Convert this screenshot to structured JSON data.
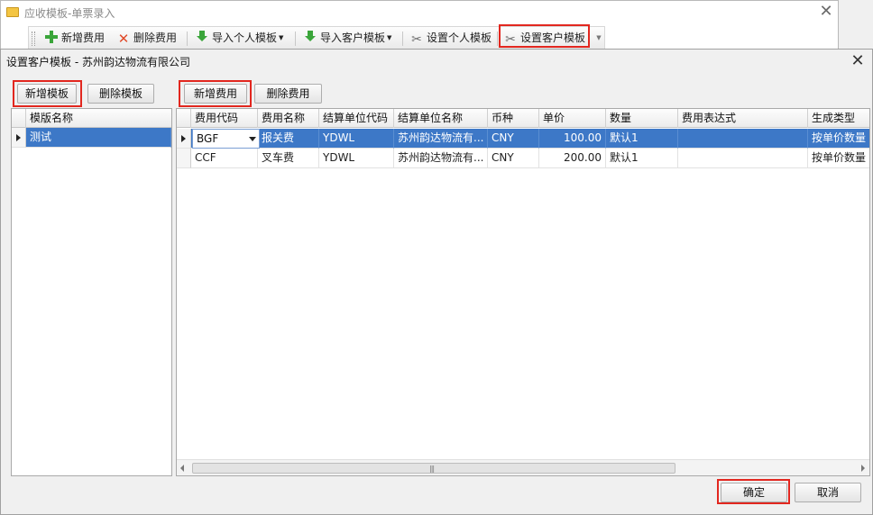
{
  "background_window": {
    "title": "应收模板-单票录入",
    "toolbar": {
      "add_fee": "新增费用",
      "delete_fee": "删除费用",
      "import_personal": "导入个人模板",
      "import_customer": "导入客户模板",
      "set_personal": "设置个人模板",
      "set_customer": "设置客户模板"
    }
  },
  "dialog": {
    "title": "设置客户模板 - 苏州韵达物流有限公司",
    "add_template": "新增模板",
    "delete_template": "删除模板",
    "add_fee": "新增费用",
    "delete_fee": "删除费用",
    "template_grid": {
      "header": "模版名称",
      "rows": [
        {
          "name": "测试",
          "selected": true
        }
      ]
    },
    "fee_grid": {
      "columns": [
        "费用代码",
        "费用名称",
        "结算单位代码",
        "结算单位名称",
        "币种",
        "单价",
        "数量",
        "费用表达式",
        "生成类型"
      ],
      "rows": [
        {
          "code": "BGF",
          "name": "报关费",
          "unit_code": "YDWL",
          "unit_name": "苏州韵达物流有...",
          "currency": "CNY",
          "price": "100.00",
          "qty": "默认1",
          "expr": "",
          "gen_type": "按单价数量",
          "selected": true
        },
        {
          "code": "CCF",
          "name": "叉车费",
          "unit_code": "YDWL",
          "unit_name": "苏州韵达物流有...",
          "currency": "CNY",
          "price": "200.00",
          "qty": "默认1",
          "expr": "",
          "gen_type": "按单价数量",
          "selected": false
        }
      ]
    },
    "ok": "确定",
    "cancel": "取消"
  },
  "colors": {
    "selection": "#3d78c7",
    "highlight_box": "#e2271f"
  }
}
